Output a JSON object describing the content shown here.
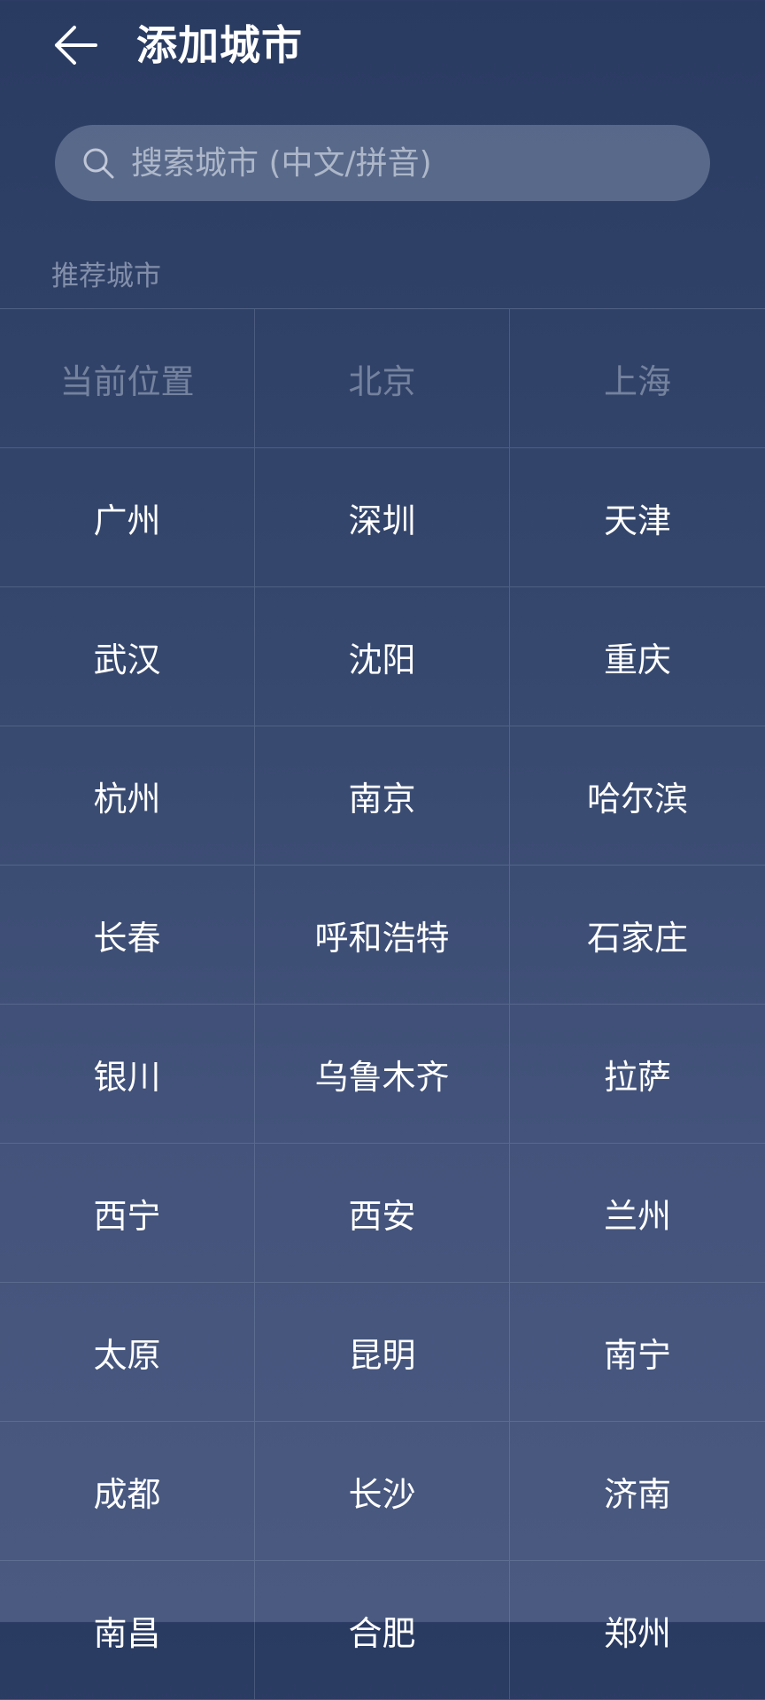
{
  "header": {
    "title": "添加城市",
    "back_icon": "arrow-left-icon"
  },
  "search": {
    "placeholder": "搜索城市 (中文/拼音)",
    "icon": "search-icon"
  },
  "section": {
    "label": "推荐城市"
  },
  "cities": [
    {
      "name": "当前位置",
      "muted": true
    },
    {
      "name": "北京",
      "muted": true
    },
    {
      "name": "上海",
      "muted": true
    },
    {
      "name": "广州",
      "muted": false
    },
    {
      "name": "深圳",
      "muted": false
    },
    {
      "name": "天津",
      "muted": false
    },
    {
      "name": "武汉",
      "muted": false
    },
    {
      "name": "沈阳",
      "muted": false
    },
    {
      "name": "重庆",
      "muted": false
    },
    {
      "name": "杭州",
      "muted": false
    },
    {
      "name": "南京",
      "muted": false
    },
    {
      "name": "哈尔滨",
      "muted": false
    },
    {
      "name": "长春",
      "muted": false
    },
    {
      "name": "呼和浩特",
      "muted": false
    },
    {
      "name": "石家庄",
      "muted": false
    },
    {
      "name": "银川",
      "muted": false
    },
    {
      "name": "乌鲁木齐",
      "muted": false
    },
    {
      "name": "拉萨",
      "muted": false
    },
    {
      "name": "西宁",
      "muted": false
    },
    {
      "name": "西安",
      "muted": false
    },
    {
      "name": "兰州",
      "muted": false
    },
    {
      "name": "太原",
      "muted": false
    },
    {
      "name": "昆明",
      "muted": false
    },
    {
      "name": "南宁",
      "muted": false
    },
    {
      "name": "成都",
      "muted": false
    },
    {
      "name": "长沙",
      "muted": false
    },
    {
      "name": "济南",
      "muted": false
    },
    {
      "name": "南昌",
      "muted": false
    },
    {
      "name": "合肥",
      "muted": false
    },
    {
      "name": "郑州",
      "muted": false
    }
  ]
}
